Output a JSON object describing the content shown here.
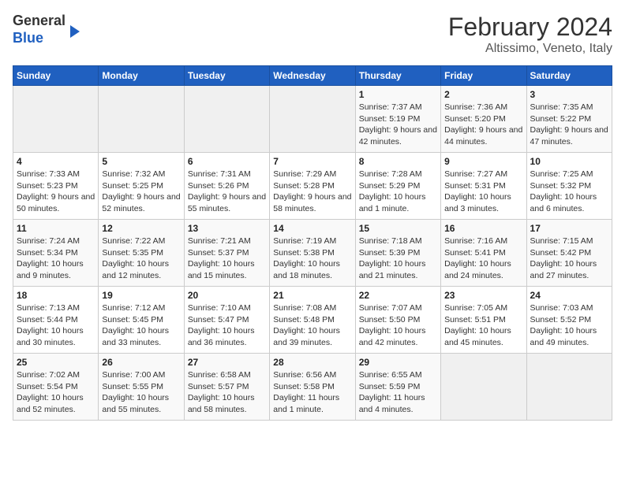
{
  "header": {
    "logo_line1": "General",
    "logo_line2": "Blue",
    "title": "February 2024",
    "subtitle": "Altissimo, Veneto, Italy"
  },
  "weekdays": [
    "Sunday",
    "Monday",
    "Tuesday",
    "Wednesday",
    "Thursday",
    "Friday",
    "Saturday"
  ],
  "weeks": [
    [
      {
        "day": "",
        "info": ""
      },
      {
        "day": "",
        "info": ""
      },
      {
        "day": "",
        "info": ""
      },
      {
        "day": "",
        "info": ""
      },
      {
        "day": "1",
        "info": "Sunrise: 7:37 AM\nSunset: 5:19 PM\nDaylight: 9 hours and 42 minutes."
      },
      {
        "day": "2",
        "info": "Sunrise: 7:36 AM\nSunset: 5:20 PM\nDaylight: 9 hours and 44 minutes."
      },
      {
        "day": "3",
        "info": "Sunrise: 7:35 AM\nSunset: 5:22 PM\nDaylight: 9 hours and 47 minutes."
      }
    ],
    [
      {
        "day": "4",
        "info": "Sunrise: 7:33 AM\nSunset: 5:23 PM\nDaylight: 9 hours and 50 minutes."
      },
      {
        "day": "5",
        "info": "Sunrise: 7:32 AM\nSunset: 5:25 PM\nDaylight: 9 hours and 52 minutes."
      },
      {
        "day": "6",
        "info": "Sunrise: 7:31 AM\nSunset: 5:26 PM\nDaylight: 9 hours and 55 minutes."
      },
      {
        "day": "7",
        "info": "Sunrise: 7:29 AM\nSunset: 5:28 PM\nDaylight: 9 hours and 58 minutes."
      },
      {
        "day": "8",
        "info": "Sunrise: 7:28 AM\nSunset: 5:29 PM\nDaylight: 10 hours and 1 minute."
      },
      {
        "day": "9",
        "info": "Sunrise: 7:27 AM\nSunset: 5:31 PM\nDaylight: 10 hours and 3 minutes."
      },
      {
        "day": "10",
        "info": "Sunrise: 7:25 AM\nSunset: 5:32 PM\nDaylight: 10 hours and 6 minutes."
      }
    ],
    [
      {
        "day": "11",
        "info": "Sunrise: 7:24 AM\nSunset: 5:34 PM\nDaylight: 10 hours and 9 minutes."
      },
      {
        "day": "12",
        "info": "Sunrise: 7:22 AM\nSunset: 5:35 PM\nDaylight: 10 hours and 12 minutes."
      },
      {
        "day": "13",
        "info": "Sunrise: 7:21 AM\nSunset: 5:37 PM\nDaylight: 10 hours and 15 minutes."
      },
      {
        "day": "14",
        "info": "Sunrise: 7:19 AM\nSunset: 5:38 PM\nDaylight: 10 hours and 18 minutes."
      },
      {
        "day": "15",
        "info": "Sunrise: 7:18 AM\nSunset: 5:39 PM\nDaylight: 10 hours and 21 minutes."
      },
      {
        "day": "16",
        "info": "Sunrise: 7:16 AM\nSunset: 5:41 PM\nDaylight: 10 hours and 24 minutes."
      },
      {
        "day": "17",
        "info": "Sunrise: 7:15 AM\nSunset: 5:42 PM\nDaylight: 10 hours and 27 minutes."
      }
    ],
    [
      {
        "day": "18",
        "info": "Sunrise: 7:13 AM\nSunset: 5:44 PM\nDaylight: 10 hours and 30 minutes."
      },
      {
        "day": "19",
        "info": "Sunrise: 7:12 AM\nSunset: 5:45 PM\nDaylight: 10 hours and 33 minutes."
      },
      {
        "day": "20",
        "info": "Sunrise: 7:10 AM\nSunset: 5:47 PM\nDaylight: 10 hours and 36 minutes."
      },
      {
        "day": "21",
        "info": "Sunrise: 7:08 AM\nSunset: 5:48 PM\nDaylight: 10 hours and 39 minutes."
      },
      {
        "day": "22",
        "info": "Sunrise: 7:07 AM\nSunset: 5:50 PM\nDaylight: 10 hours and 42 minutes."
      },
      {
        "day": "23",
        "info": "Sunrise: 7:05 AM\nSunset: 5:51 PM\nDaylight: 10 hours and 45 minutes."
      },
      {
        "day": "24",
        "info": "Sunrise: 7:03 AM\nSunset: 5:52 PM\nDaylight: 10 hours and 49 minutes."
      }
    ],
    [
      {
        "day": "25",
        "info": "Sunrise: 7:02 AM\nSunset: 5:54 PM\nDaylight: 10 hours and 52 minutes."
      },
      {
        "day": "26",
        "info": "Sunrise: 7:00 AM\nSunset: 5:55 PM\nDaylight: 10 hours and 55 minutes."
      },
      {
        "day": "27",
        "info": "Sunrise: 6:58 AM\nSunset: 5:57 PM\nDaylight: 10 hours and 58 minutes."
      },
      {
        "day": "28",
        "info": "Sunrise: 6:56 AM\nSunset: 5:58 PM\nDaylight: 11 hours and 1 minute."
      },
      {
        "day": "29",
        "info": "Sunrise: 6:55 AM\nSunset: 5:59 PM\nDaylight: 11 hours and 4 minutes."
      },
      {
        "day": "",
        "info": ""
      },
      {
        "day": "",
        "info": ""
      }
    ]
  ]
}
